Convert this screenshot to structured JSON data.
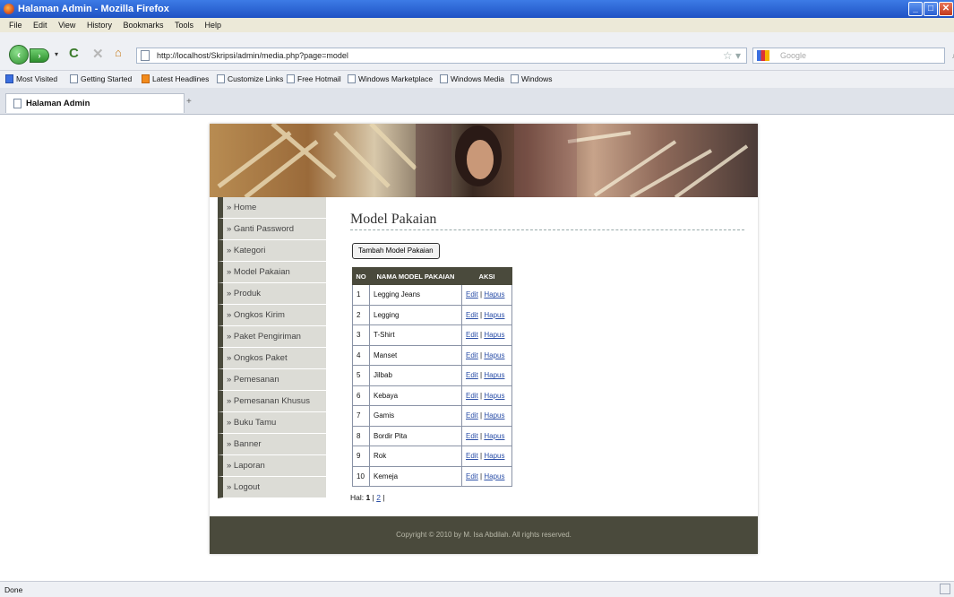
{
  "window": {
    "title": "Halaman Admin - Mozilla Firefox"
  },
  "menu": [
    "File",
    "Edit",
    "View",
    "History",
    "Bookmarks",
    "Tools",
    "Help"
  ],
  "nav": {
    "url": "http://localhost/Skripsi/admin/media.php?page=model",
    "search_placeholder": "Google"
  },
  "bookmarks": [
    {
      "label": "Most Visited",
      "icon": "most-visited-icon"
    },
    {
      "label": "Getting Started",
      "icon": "page-icon"
    },
    {
      "label": "Latest Headlines",
      "icon": "rss-icon"
    },
    {
      "label": "Customize Links",
      "icon": "page-icon"
    },
    {
      "label": "Free Hotmail",
      "icon": "page-icon"
    },
    {
      "label": "Windows Marketplace",
      "icon": "page-icon"
    },
    {
      "label": "Windows Media",
      "icon": "page-icon"
    },
    {
      "label": "Windows",
      "icon": "page-icon"
    }
  ],
  "tab": {
    "label": "Halaman Admin",
    "new_tab": "+"
  },
  "sidebar": [
    "» Home",
    "» Ganti Password",
    "» Kategori",
    "» Model Pakaian",
    "» Produk",
    "» Ongkos Kirim",
    "» Paket Pengiriman",
    "» Ongkos Paket",
    "» Pemesanan",
    "» Pemesanan Khusus",
    "» Buku Tamu",
    "» Banner",
    "» Laporan",
    "» Logout"
  ],
  "content": {
    "title": "Model Pakaian",
    "add_button": "Tambah Model Pakaian",
    "table": {
      "headers": [
        "NO",
        "NAMA MODEL PAKAIAN",
        "AKSI"
      ],
      "rows": [
        {
          "no": "1",
          "name": "Legging Jeans"
        },
        {
          "no": "2",
          "name": "Legging"
        },
        {
          "no": "3",
          "name": "T-Shirt"
        },
        {
          "no": "4",
          "name": "Manset"
        },
        {
          "no": "5",
          "name": "Jilbab"
        },
        {
          "no": "6",
          "name": "Kebaya"
        },
        {
          "no": "7",
          "name": "Gamis"
        },
        {
          "no": "8",
          "name": "Bordir Pita"
        },
        {
          "no": "9",
          "name": "Rok"
        },
        {
          "no": "10",
          "name": "Kemeja"
        }
      ],
      "edit_label": "Edit",
      "separator": "|",
      "delete_label": "Hapus"
    },
    "pager": {
      "prefix": "Hal:",
      "current": "1",
      "sep": "|",
      "next": "2",
      "end": "|"
    }
  },
  "footer": "Copyright © 2010 by M. Isa Abdilah. All rights reserved.",
  "status": "Done"
}
